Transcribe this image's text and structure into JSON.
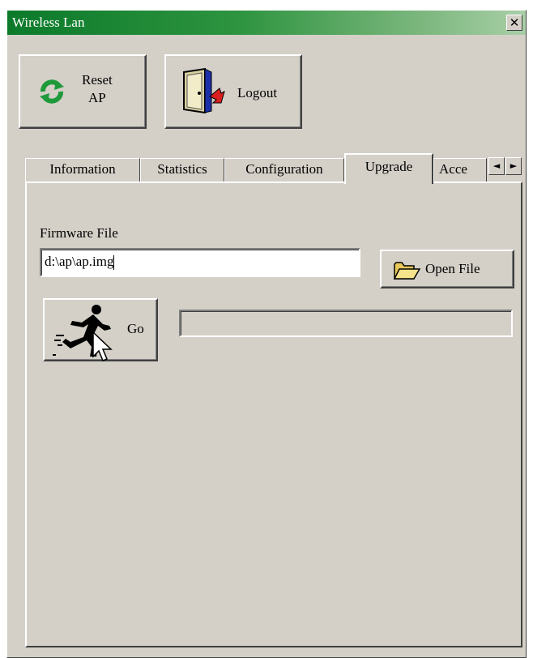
{
  "window": {
    "title": "Wireless Lan",
    "close_glyph": "✕"
  },
  "toolbar": {
    "reset_line1": "Reset",
    "reset_line2": "AP",
    "logout_label": "Logout",
    "reset_icon": "refresh-icon",
    "logout_icon": "door-exit-icon"
  },
  "tabs": [
    {
      "label": "Information",
      "active": false
    },
    {
      "label": "Statistics",
      "active": false
    },
    {
      "label": "Configuration",
      "active": false
    },
    {
      "label": "Upgrade",
      "active": true
    },
    {
      "label": "Acce",
      "active": false
    }
  ],
  "tab_scroll": {
    "left": "◄",
    "right": "►"
  },
  "upgrade": {
    "firmware_label": "Firmware File",
    "firmware_value": "d:\\ap\\ap.img",
    "open_file_label": "Open File",
    "open_file_icon": "folder-open-icon",
    "go_label": "Go",
    "go_icon": "running-man-icon",
    "progress": 0
  },
  "colors": {
    "title_gradient_start": "#0b7a2a",
    "title_gradient_end": "#a9cfa7",
    "face": "#d4d0c8"
  }
}
